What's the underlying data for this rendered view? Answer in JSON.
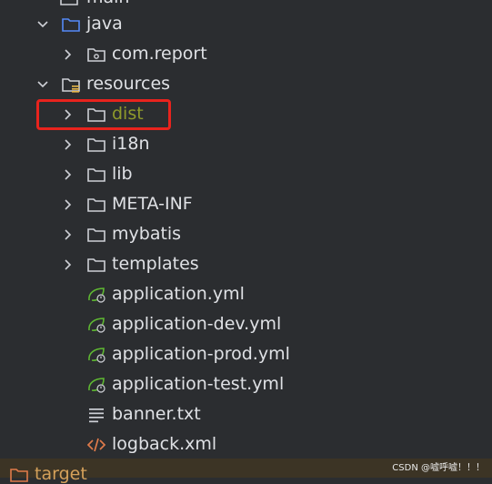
{
  "tree": {
    "top_partial_label": "main",
    "java": {
      "label": "java"
    },
    "com_report": {
      "label": "com.report"
    },
    "resources": {
      "label": "resources"
    },
    "dist": {
      "label": "dist"
    },
    "i18n": {
      "label": "i18n"
    },
    "lib": {
      "label": "lib"
    },
    "meta_inf": {
      "label": "META-INF"
    },
    "mybatis": {
      "label": "mybatis"
    },
    "templates": {
      "label": "templates"
    },
    "app_yml": {
      "label": "application.yml"
    },
    "app_dev": {
      "label": "application-dev.yml"
    },
    "app_prod": {
      "label": "application-prod.yml"
    },
    "app_test": {
      "label": "application-test.yml"
    },
    "banner": {
      "label": "banner.txt"
    },
    "logback": {
      "label": "logback.xml"
    },
    "target": {
      "label": "target"
    }
  },
  "watermark": "CSDN @嘘呼嘘！！！",
  "colors": {
    "background": "#2b2d30",
    "text": "#dfe1e5",
    "highlight_border": "#e8231d",
    "excluded_text": "#8f9a2b",
    "source_folder": "#548af7",
    "spring_icon": "#5fb832",
    "xml_icon": "#e07b4a"
  }
}
